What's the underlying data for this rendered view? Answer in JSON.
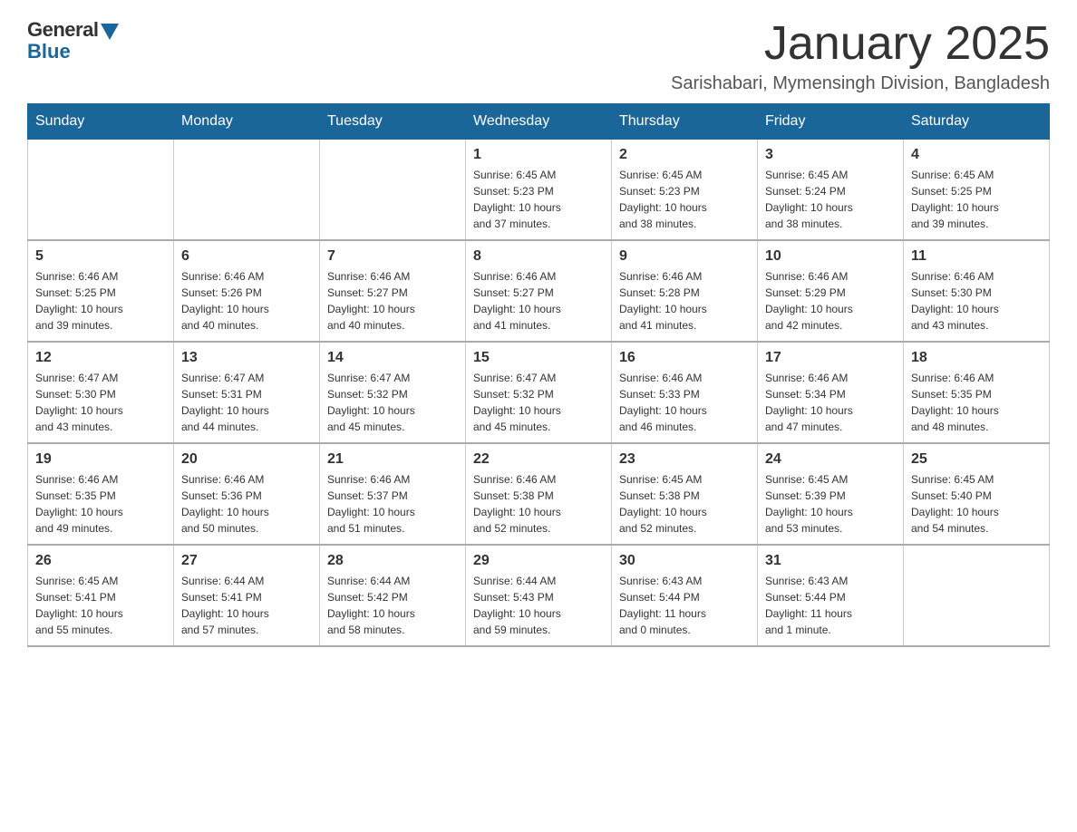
{
  "header": {
    "logo": {
      "general": "General",
      "blue": "Blue"
    },
    "title": "January 2025",
    "location": "Sarishabari, Mymensingh Division, Bangladesh"
  },
  "days_of_week": [
    "Sunday",
    "Monday",
    "Tuesday",
    "Wednesday",
    "Thursday",
    "Friday",
    "Saturday"
  ],
  "weeks": [
    [
      {
        "day": "",
        "info": ""
      },
      {
        "day": "",
        "info": ""
      },
      {
        "day": "",
        "info": ""
      },
      {
        "day": "1",
        "info": "Sunrise: 6:45 AM\nSunset: 5:23 PM\nDaylight: 10 hours\nand 37 minutes."
      },
      {
        "day": "2",
        "info": "Sunrise: 6:45 AM\nSunset: 5:23 PM\nDaylight: 10 hours\nand 38 minutes."
      },
      {
        "day": "3",
        "info": "Sunrise: 6:45 AM\nSunset: 5:24 PM\nDaylight: 10 hours\nand 38 minutes."
      },
      {
        "day": "4",
        "info": "Sunrise: 6:45 AM\nSunset: 5:25 PM\nDaylight: 10 hours\nand 39 minutes."
      }
    ],
    [
      {
        "day": "5",
        "info": "Sunrise: 6:46 AM\nSunset: 5:25 PM\nDaylight: 10 hours\nand 39 minutes."
      },
      {
        "day": "6",
        "info": "Sunrise: 6:46 AM\nSunset: 5:26 PM\nDaylight: 10 hours\nand 40 minutes."
      },
      {
        "day": "7",
        "info": "Sunrise: 6:46 AM\nSunset: 5:27 PM\nDaylight: 10 hours\nand 40 minutes."
      },
      {
        "day": "8",
        "info": "Sunrise: 6:46 AM\nSunset: 5:27 PM\nDaylight: 10 hours\nand 41 minutes."
      },
      {
        "day": "9",
        "info": "Sunrise: 6:46 AM\nSunset: 5:28 PM\nDaylight: 10 hours\nand 41 minutes."
      },
      {
        "day": "10",
        "info": "Sunrise: 6:46 AM\nSunset: 5:29 PM\nDaylight: 10 hours\nand 42 minutes."
      },
      {
        "day": "11",
        "info": "Sunrise: 6:46 AM\nSunset: 5:30 PM\nDaylight: 10 hours\nand 43 minutes."
      }
    ],
    [
      {
        "day": "12",
        "info": "Sunrise: 6:47 AM\nSunset: 5:30 PM\nDaylight: 10 hours\nand 43 minutes."
      },
      {
        "day": "13",
        "info": "Sunrise: 6:47 AM\nSunset: 5:31 PM\nDaylight: 10 hours\nand 44 minutes."
      },
      {
        "day": "14",
        "info": "Sunrise: 6:47 AM\nSunset: 5:32 PM\nDaylight: 10 hours\nand 45 minutes."
      },
      {
        "day": "15",
        "info": "Sunrise: 6:47 AM\nSunset: 5:32 PM\nDaylight: 10 hours\nand 45 minutes."
      },
      {
        "day": "16",
        "info": "Sunrise: 6:46 AM\nSunset: 5:33 PM\nDaylight: 10 hours\nand 46 minutes."
      },
      {
        "day": "17",
        "info": "Sunrise: 6:46 AM\nSunset: 5:34 PM\nDaylight: 10 hours\nand 47 minutes."
      },
      {
        "day": "18",
        "info": "Sunrise: 6:46 AM\nSunset: 5:35 PM\nDaylight: 10 hours\nand 48 minutes."
      }
    ],
    [
      {
        "day": "19",
        "info": "Sunrise: 6:46 AM\nSunset: 5:35 PM\nDaylight: 10 hours\nand 49 minutes."
      },
      {
        "day": "20",
        "info": "Sunrise: 6:46 AM\nSunset: 5:36 PM\nDaylight: 10 hours\nand 50 minutes."
      },
      {
        "day": "21",
        "info": "Sunrise: 6:46 AM\nSunset: 5:37 PM\nDaylight: 10 hours\nand 51 minutes."
      },
      {
        "day": "22",
        "info": "Sunrise: 6:46 AM\nSunset: 5:38 PM\nDaylight: 10 hours\nand 52 minutes."
      },
      {
        "day": "23",
        "info": "Sunrise: 6:45 AM\nSunset: 5:38 PM\nDaylight: 10 hours\nand 52 minutes."
      },
      {
        "day": "24",
        "info": "Sunrise: 6:45 AM\nSunset: 5:39 PM\nDaylight: 10 hours\nand 53 minutes."
      },
      {
        "day": "25",
        "info": "Sunrise: 6:45 AM\nSunset: 5:40 PM\nDaylight: 10 hours\nand 54 minutes."
      }
    ],
    [
      {
        "day": "26",
        "info": "Sunrise: 6:45 AM\nSunset: 5:41 PM\nDaylight: 10 hours\nand 55 minutes."
      },
      {
        "day": "27",
        "info": "Sunrise: 6:44 AM\nSunset: 5:41 PM\nDaylight: 10 hours\nand 57 minutes."
      },
      {
        "day": "28",
        "info": "Sunrise: 6:44 AM\nSunset: 5:42 PM\nDaylight: 10 hours\nand 58 minutes."
      },
      {
        "day": "29",
        "info": "Sunrise: 6:44 AM\nSunset: 5:43 PM\nDaylight: 10 hours\nand 59 minutes."
      },
      {
        "day": "30",
        "info": "Sunrise: 6:43 AM\nSunset: 5:44 PM\nDaylight: 11 hours\nand 0 minutes."
      },
      {
        "day": "31",
        "info": "Sunrise: 6:43 AM\nSunset: 5:44 PM\nDaylight: 11 hours\nand 1 minute."
      },
      {
        "day": "",
        "info": ""
      }
    ]
  ]
}
